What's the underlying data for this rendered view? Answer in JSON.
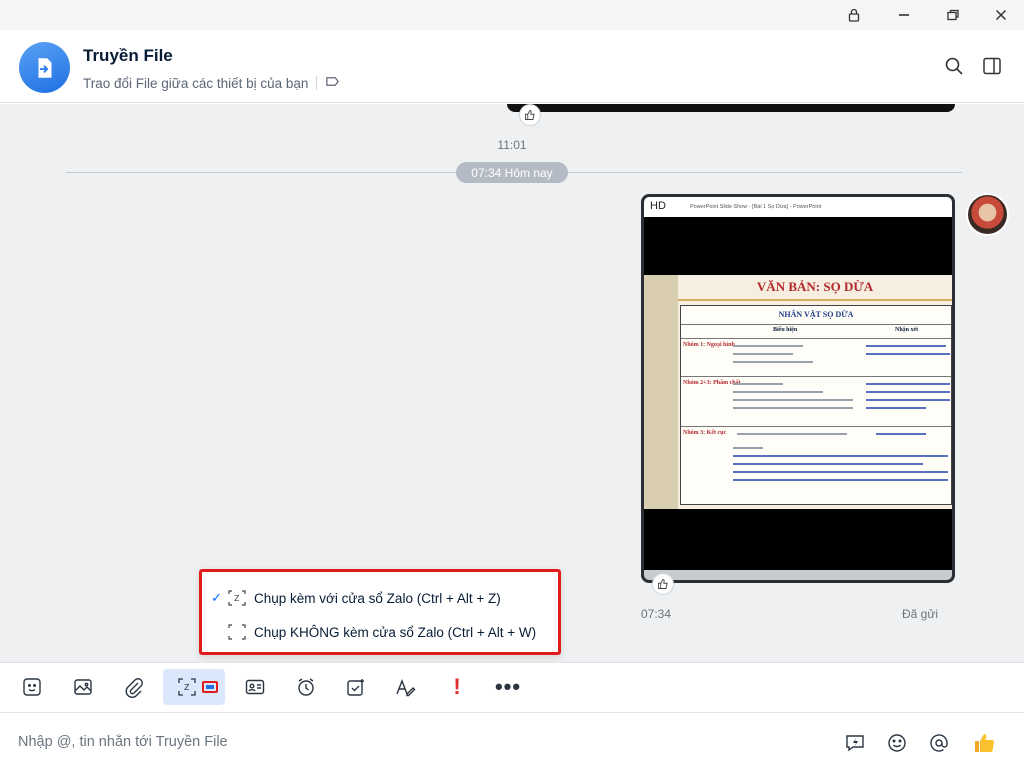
{
  "header": {
    "title": "Truyền File",
    "subtitle": "Trao đổi File giữa các thiết bị của bạn"
  },
  "chat": {
    "prev_time": "11:01",
    "date_divider": "07:34 Hôm nay",
    "image_message": {
      "hd_label": "HD",
      "window_title": "PowerPoint Slide Show - [Bài 1 Sọ Dừa] - PowerPoint",
      "slide_title": "VĂN BẢN: SỌ DỪA",
      "table_title": "NHÂN VẬT SỌ DỪA",
      "col_headers": [
        "Biểu hiện",
        "Nhận xét"
      ],
      "rows": [
        "Nhóm 1: Ngoại hình",
        "Nhóm 2+3: Phẩm chất",
        "Nhóm 3: Kết cục"
      ],
      "time": "07:34",
      "status": "Đã gửi"
    }
  },
  "capture_menu": {
    "items": [
      {
        "label": "Chụp kèm với cửa sổ Zalo (Ctrl + Alt + Z)",
        "checked": true
      },
      {
        "label": "Chụp KHÔNG kèm cửa sổ Zalo (Ctrl + Alt + W)",
        "checked": false
      }
    ],
    "check_mark": "✓"
  },
  "toolbar": {
    "exclamation": "!",
    "more": "•••"
  },
  "composer": {
    "placeholder": "Nhập @, tin nhắn tới Truyền File"
  },
  "colors": {
    "accent": "#0068ff",
    "highlight_border": "#e01b1b",
    "chat_bg": "#eef0f1"
  }
}
